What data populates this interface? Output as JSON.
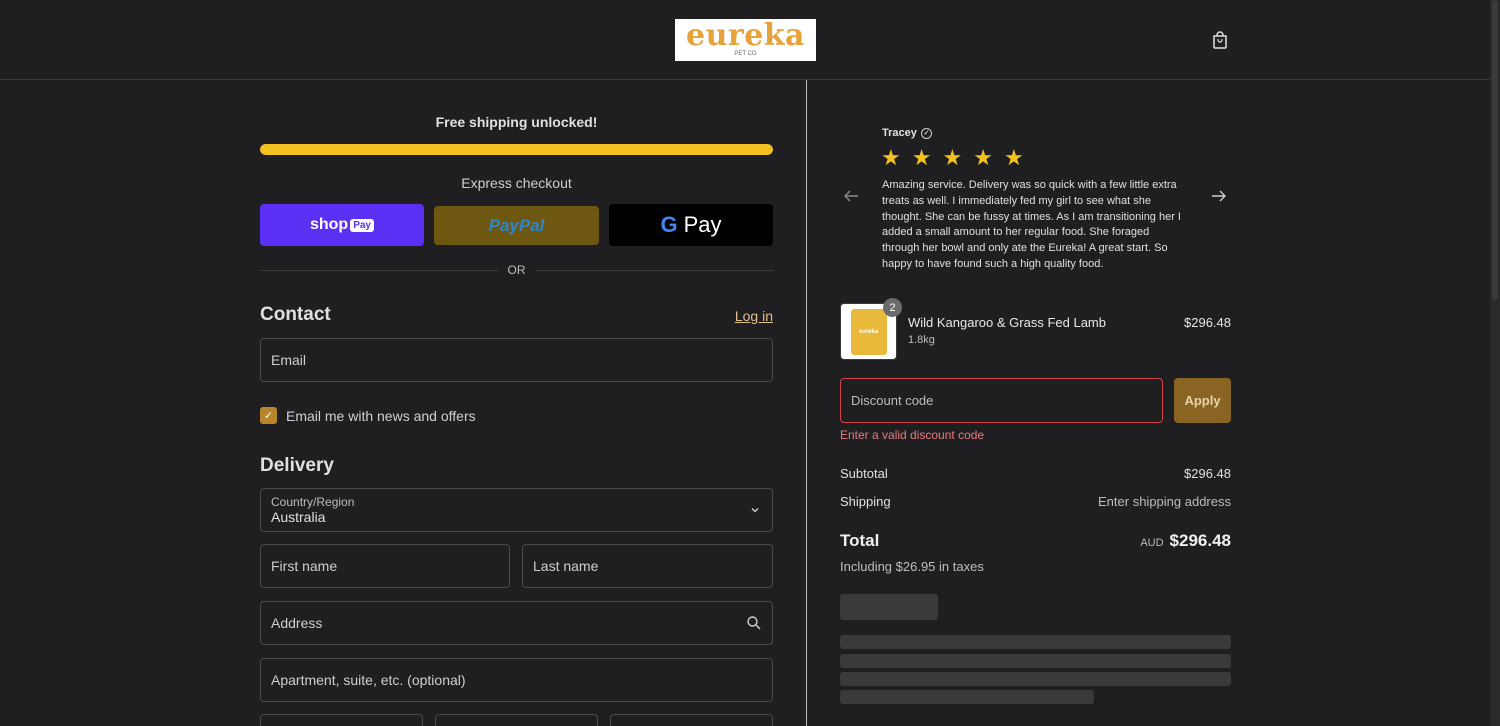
{
  "header": {
    "logo_text": "eureka",
    "logo_sub": "PET CO",
    "cart_icon": "shopping-bag-icon"
  },
  "shipping_banner": {
    "text": "Free shipping unlocked!",
    "progress": 1.0,
    "progress_color": "#f4c21e"
  },
  "express": {
    "title": "Express checkout",
    "shop_label": "shop",
    "shop_tag": "Pay",
    "paypal_label": "PayPal",
    "gpay_g": "G",
    "gpay_label": "Pay",
    "or_label": "OR"
  },
  "contact": {
    "title": "Contact",
    "login_label": "Log in",
    "email_placeholder": "Email",
    "newsletter_label": "Email me with news and offers",
    "newsletter_checked": true
  },
  "delivery": {
    "title": "Delivery",
    "country_label": "Country/Region",
    "country_value": "Australia",
    "first_name": "First name",
    "last_name": "Last name",
    "address": "Address",
    "apartment": "Apartment, suite, etc. (optional)"
  },
  "review": {
    "name": "Tracey",
    "rating": 5,
    "text": "Amazing service. Delivery was so quick with a few little extra treats as well. I immediately fed my girl to see what she thought. She can be fussy at times. As I am transitioning her I added a small amount to her regular food. She foraged through her bowl and only ate the Eureka! A great start. So happy to have found such a high quality food."
  },
  "cart_item": {
    "quantity": "2",
    "name": "Wild Kangaroo & Grass Fed Lamb",
    "variant": "1.8kg",
    "price": "$296.48"
  },
  "discount": {
    "placeholder": "Discount code",
    "apply_label": "Apply",
    "error": "Enter a valid discount code"
  },
  "summary": {
    "subtotal_label": "Subtotal",
    "subtotal_value": "$296.48",
    "shipping_label": "Shipping",
    "shipping_value": "Enter shipping address",
    "total_label": "Total",
    "currency": "AUD",
    "total_value": "$296.48",
    "taxes": "Including $26.95 in taxes"
  }
}
